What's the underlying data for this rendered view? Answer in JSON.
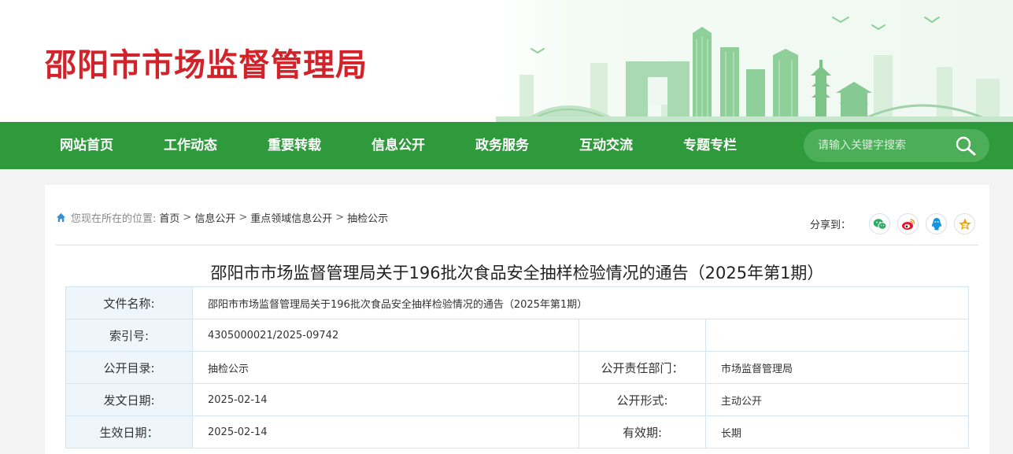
{
  "header": {
    "site_title": "邵阳市市场监督管理局"
  },
  "nav": {
    "items": [
      {
        "label": "网站首页"
      },
      {
        "label": "工作动态"
      },
      {
        "label": "重要转载"
      },
      {
        "label": "信息公开"
      },
      {
        "label": "政务服务"
      },
      {
        "label": "互动交流"
      },
      {
        "label": "专题专栏"
      }
    ],
    "search_placeholder": "请输入关键字搜索",
    "search_icon": "search-icon"
  },
  "breadcrumb": {
    "label": "您现在所在的位置:",
    "items": [
      "首页",
      "信息公开",
      "重点领域信息公开",
      "抽检公示"
    ],
    "separator": ">"
  },
  "share": {
    "label": "分享到：",
    "buttons": [
      {
        "icon": "wechat-icon",
        "color": "#2aae67"
      },
      {
        "icon": "weibo-icon",
        "color": "#e6162d"
      },
      {
        "icon": "qq-icon",
        "color": "#1296db"
      },
      {
        "icon": "qzone-icon",
        "color": "#f0a30a"
      }
    ]
  },
  "document": {
    "title": "邵阳市市场监督管理局关于196批次食品安全抽样检验情况的通告（2025年第1期）",
    "meta": {
      "file_name_label": "文件名称:",
      "file_name": "邵阳市市场监督管理局关于196批次食品安全抽样检验情况的通告（2025年第1期）",
      "index_label": "索引号:",
      "index_no": "4305000021/2025-09742",
      "catalog_label": "公开目录:",
      "catalog": "抽检公示",
      "dept_label": "公开责任部门：",
      "dept": "市场监督管理局",
      "issue_date_label": "发文日期:",
      "issue_date": "2025-02-14",
      "form_label": "公开形式:",
      "form": "主动公开",
      "effective_date_label": "生效日期：",
      "effective_date": "2025-02-14",
      "validity_label": "有效期:",
      "validity": "长期"
    }
  },
  "colors": {
    "brand_red": "#d3232a",
    "nav_green": "#2e9a3c"
  }
}
